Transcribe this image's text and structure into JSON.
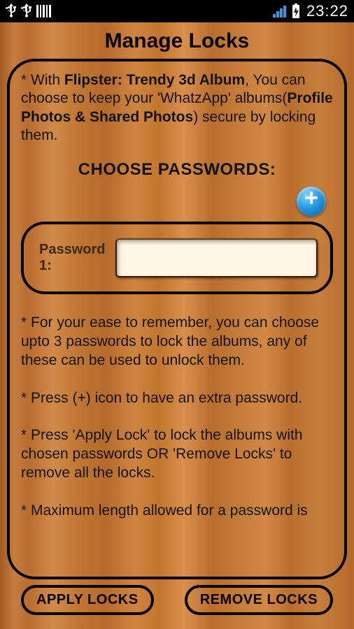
{
  "status": {
    "time": "23:22"
  },
  "page": {
    "title": "Manage Locks",
    "intro_prefix": "* With ",
    "intro_bold1": "Flipster: Trendy 3d Album",
    "intro_mid": ", You can choose to keep your 'WhatzApp' albums(",
    "intro_bold2": "Profile Photos & Shared Photos",
    "intro_suffix": ") secure by locking them.",
    "choose_title": "CHOOSE PASSWORDS:",
    "password_label": "Password 1:",
    "password_value": "",
    "help": "* For your ease to remember, you can choose upto 3 passwords to lock the albums, any of these can be used to unlock them.\n\n* Press (+) icon to have an extra password.\n\n* Press 'Apply Lock' to lock the albums with chosen passwords OR 'Remove Locks' to remove all the locks.\n\n* Maximum length allowed for a password is"
  },
  "footer": {
    "apply": "APPLY LOCKS",
    "remove": "REMOVE LOCKS"
  }
}
